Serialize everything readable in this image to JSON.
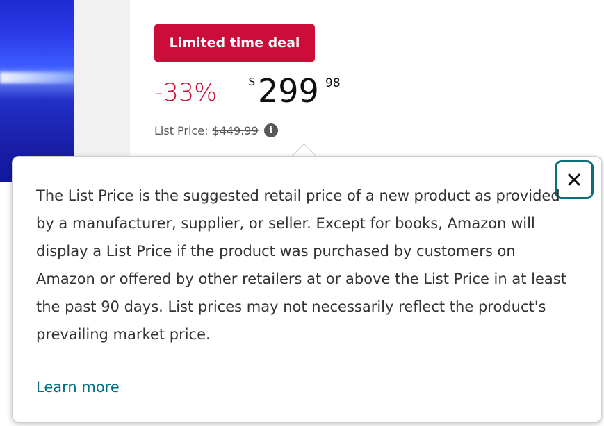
{
  "deal": {
    "badge": "Limited time deal"
  },
  "price": {
    "discount": "-33%",
    "currency": "$",
    "whole": "299",
    "fraction": "98",
    "list_label": "List Price:",
    "list_value": "$449.99"
  },
  "popover": {
    "text": "The List Price is the suggested retail price of a new product as provided by a manufacturer, supplier, or seller. Except for books, Amazon will display a List Price if the product was purchased by customers on Amazon or offered by other retailers at or above the List Price in at least the past 90 days. List prices may not necessarily reflect the product's prevailing market price.",
    "learn_more": "Learn more"
  },
  "colors": {
    "deal_red": "#cc0c39",
    "link_teal": "#007185",
    "close_border": "#0d6d7c"
  }
}
